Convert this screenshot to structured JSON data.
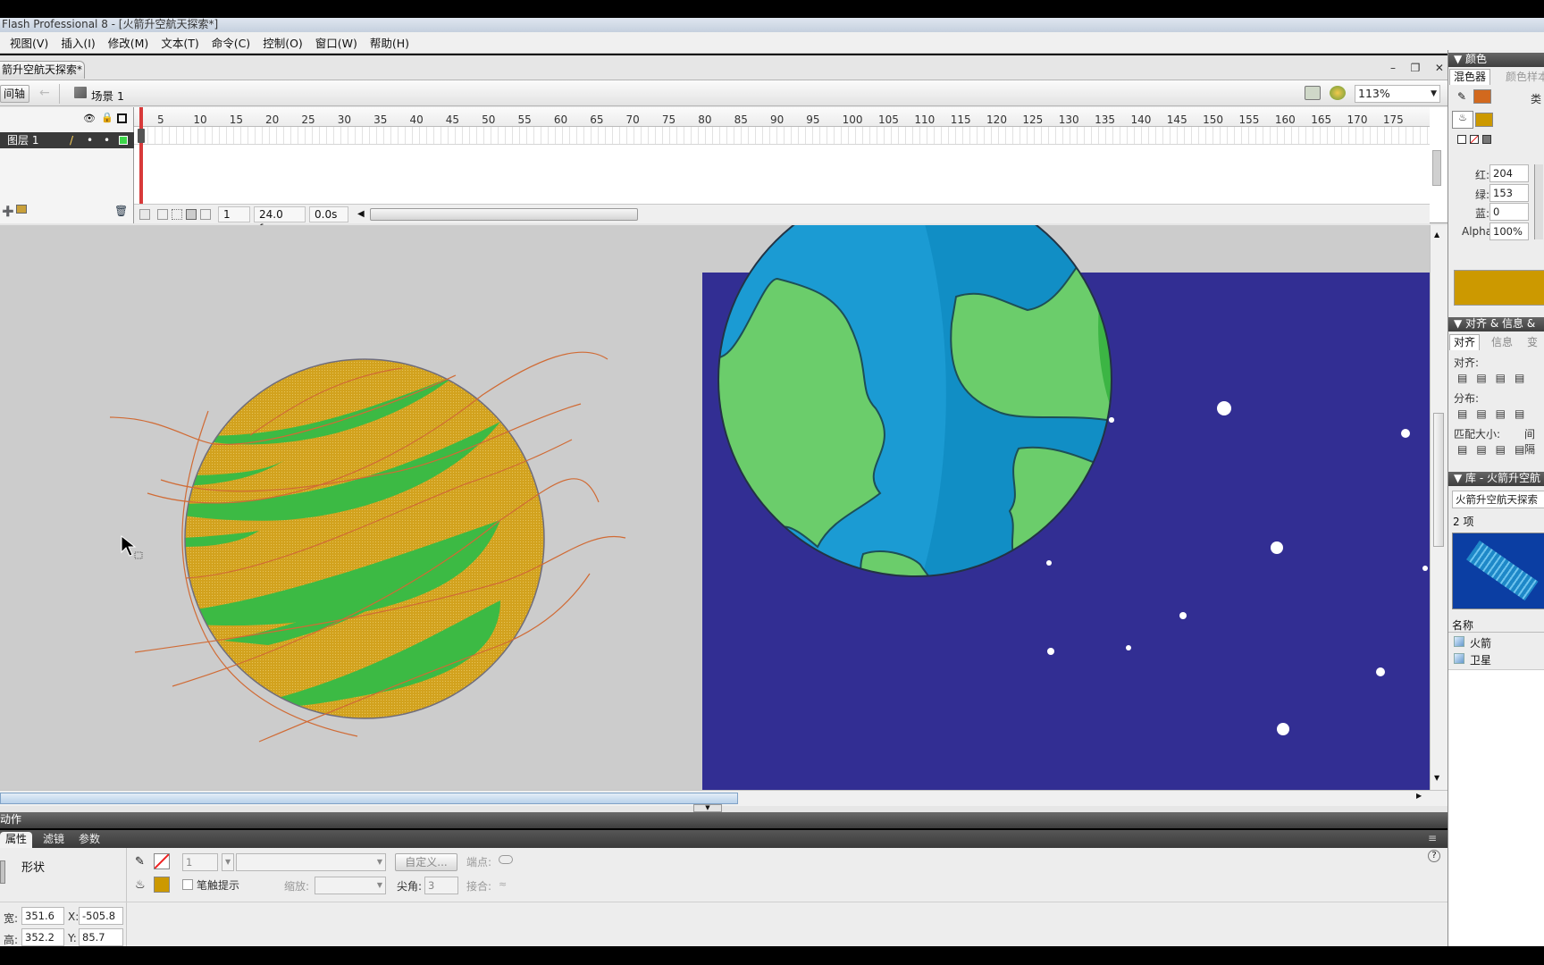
{
  "window": {
    "title": "Flash Professional 8 - [火箭升空航天探索*]"
  },
  "menu": [
    "视图(V)",
    "插入(I)",
    "修改(M)",
    "文本(T)",
    "命令(C)",
    "控制(O)",
    "窗口(W)",
    "帮助(H)"
  ],
  "document": {
    "tab": "箭升空航天探索*",
    "timeline_btn": "间轴",
    "scene": "场景 1",
    "zoom": "113%"
  },
  "timeline": {
    "layer_name": "图层 1",
    "ruler": [
      "5",
      "10",
      "15",
      "20",
      "25",
      "30",
      "35",
      "40",
      "45",
      "50",
      "55",
      "60",
      "65",
      "70",
      "75",
      "80",
      "85",
      "90",
      "95",
      "100",
      "105",
      "110",
      "115",
      "120",
      "125",
      "130",
      "135",
      "140",
      "145",
      "150",
      "155",
      "160",
      "165",
      "170",
      "175"
    ],
    "current_frame": "1",
    "fps": "24.0 fps",
    "time": "0.0s"
  },
  "panels": {
    "actions": "动作",
    "tabs": [
      "属性",
      "滤镜",
      "参数"
    ]
  },
  "properties": {
    "shape_label": "形状",
    "stroke_height": "1",
    "custom_btn": "自定义...",
    "cap_label": "端点:",
    "stroke_hint": "笔触提示",
    "scale_label": "缩放:",
    "miter_label": "尖角:",
    "miter_value": "3",
    "join_label": "接合:",
    "w_label": "宽:",
    "w": "351.6",
    "x_label": "X:",
    "x": "-505.8",
    "h_label": "高:",
    "h": "352.2",
    "y_label": "Y:",
    "y": "85.7",
    "help": "?"
  },
  "color_panel": {
    "title": "颜色",
    "tab_mixer": "混色器",
    "tab_swatches": "颜色样本",
    "type_label": "类",
    "r_label": "红:",
    "r": "204",
    "g_label": "绿:",
    "g": "153",
    "b_label": "蓝:",
    "b": "0",
    "alpha_label": "Alpha:",
    "alpha": "100%",
    "stroke_color": "#d2691e",
    "fill_color": "#cc9900"
  },
  "align_panel": {
    "title": "对齐 & 信息 &",
    "tabs": [
      "对齐",
      "信息",
      "变"
    ],
    "align": "对齐:",
    "distribute": "分布:",
    "match_size": "匹配大小:",
    "spacing": "间隔"
  },
  "library": {
    "title": "库 - 火箭升空航",
    "doc": "火箭升空航天探索",
    "count": "2 项",
    "name_col": "名称",
    "items": [
      "火箭",
      "卫星"
    ]
  },
  "colors": {
    "space": "#322e93",
    "planet_orange": "#d2a21e",
    "band_green": "#3cba44",
    "earth_ocean": "#1b9bd3",
    "earth_land": "#6bcd6b"
  }
}
